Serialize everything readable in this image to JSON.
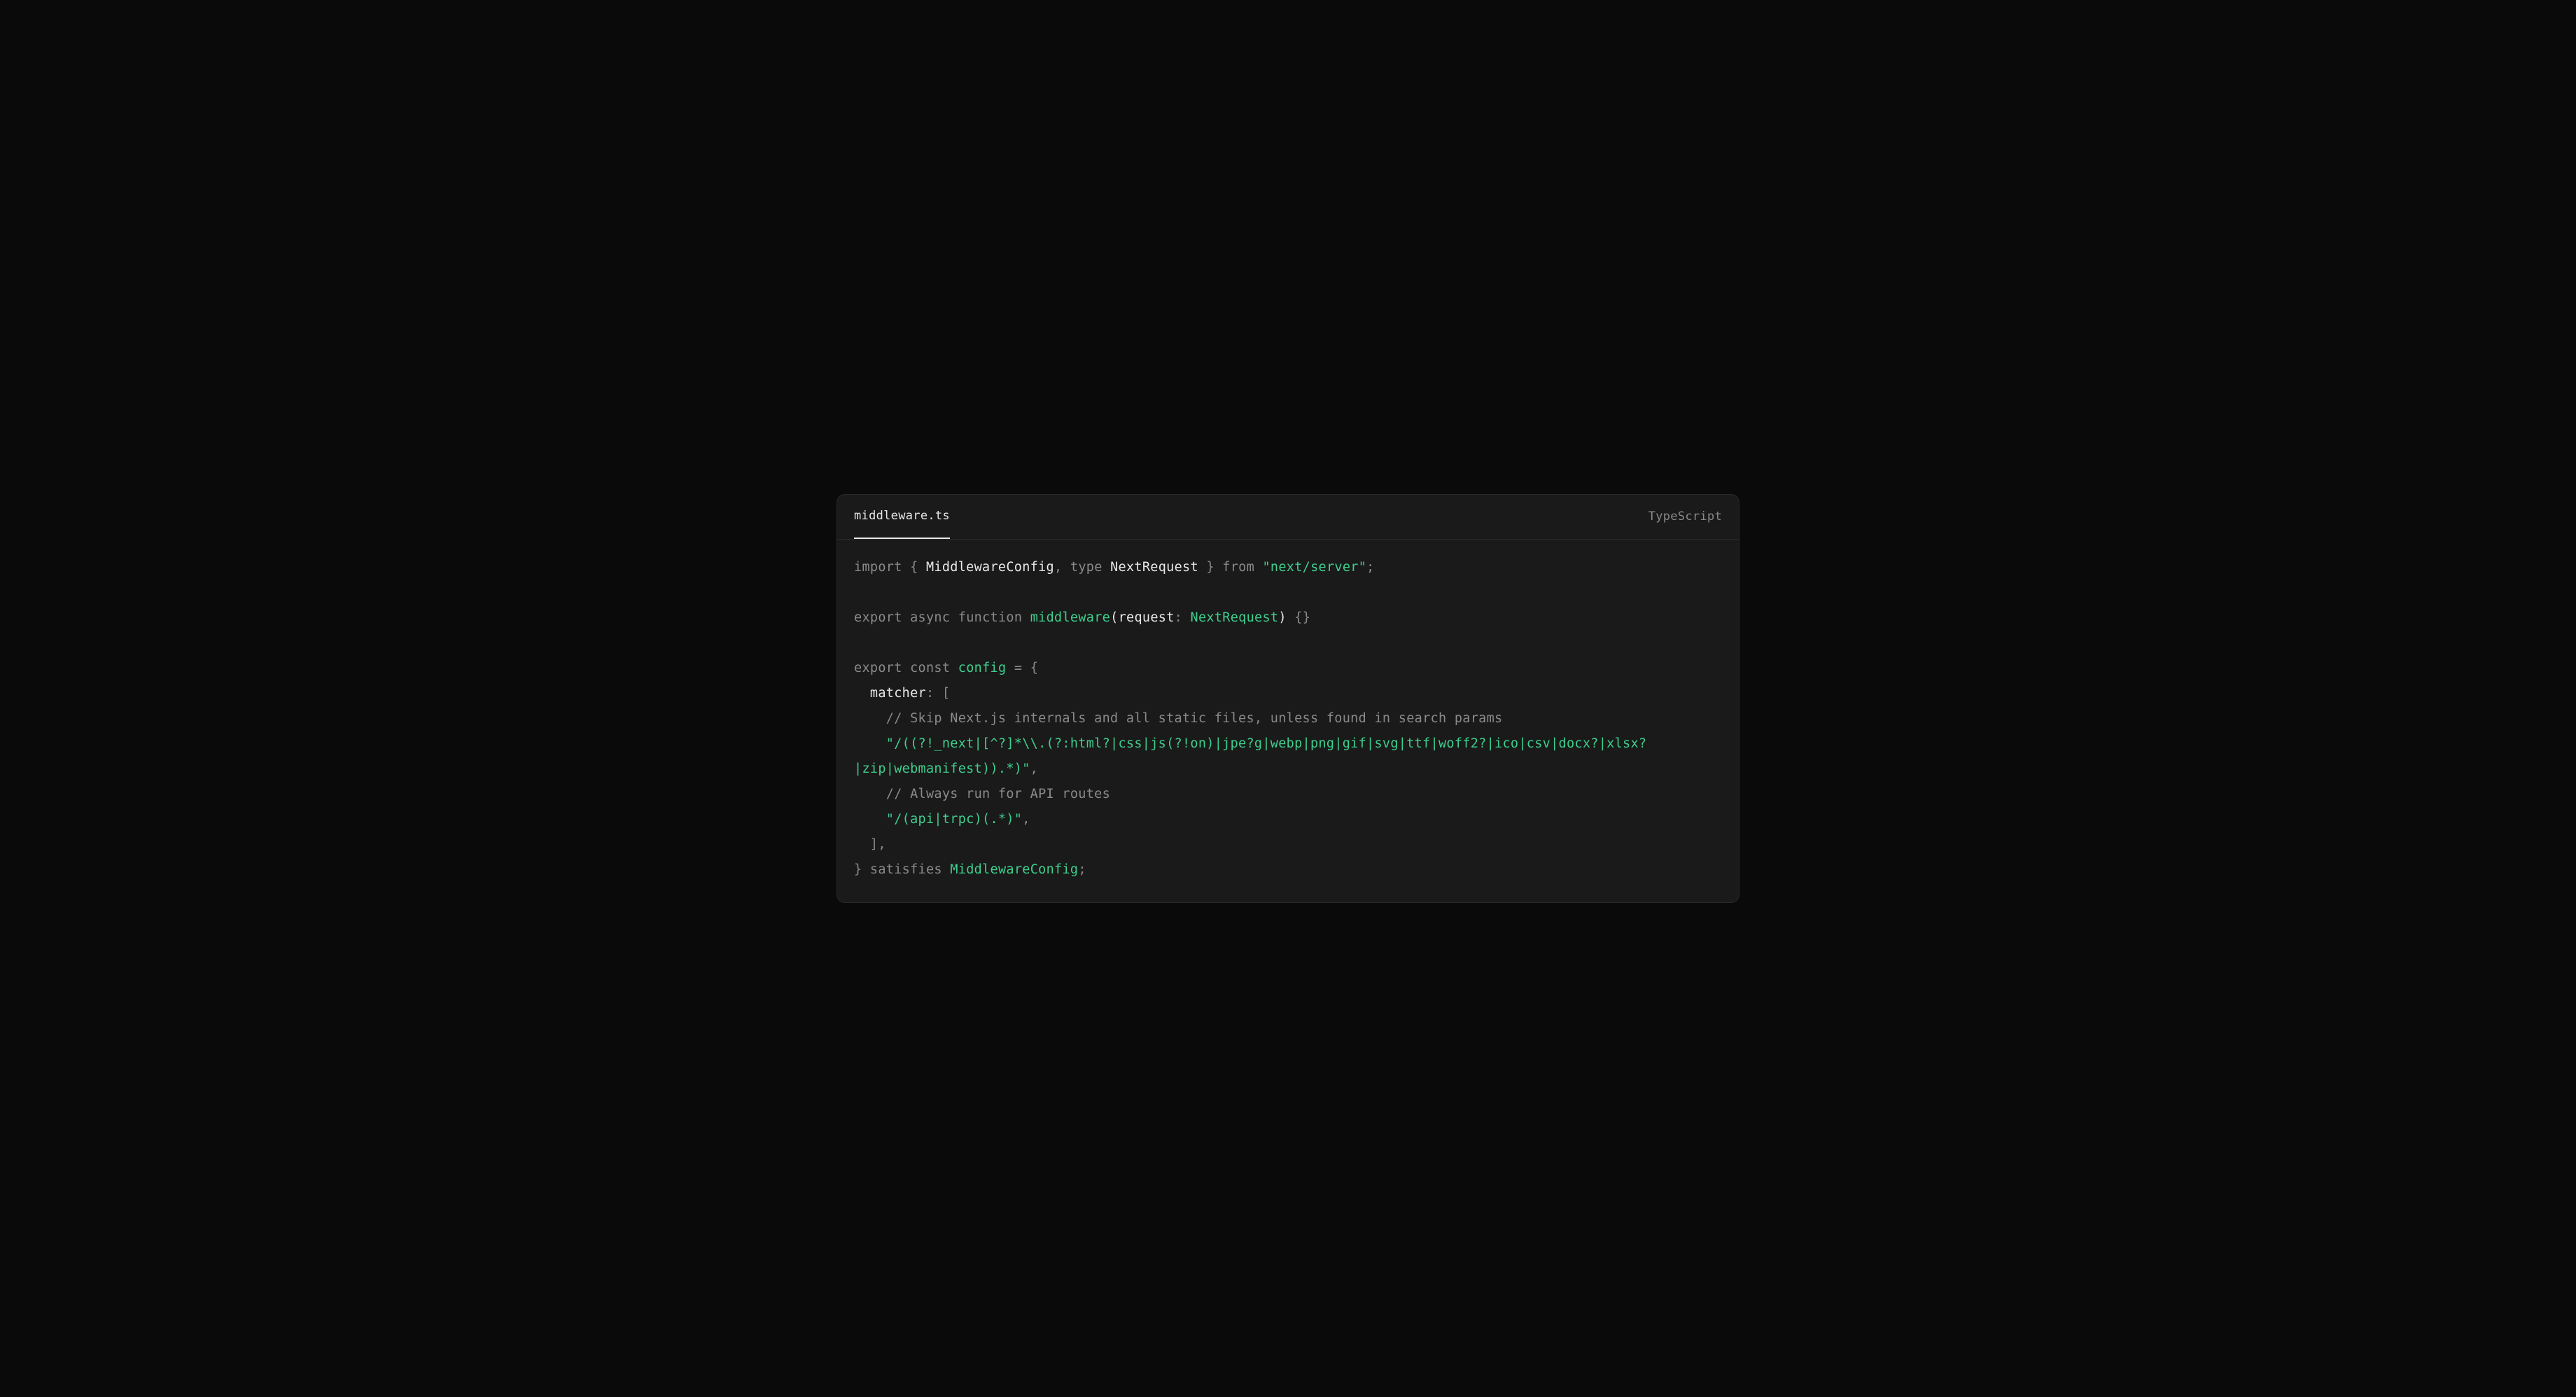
{
  "header": {
    "filename": "middleware.ts",
    "language": "TypeScript"
  },
  "code": {
    "import_kw": "import",
    "import_type1": "MiddlewareConfig",
    "type_kw": "type",
    "import_type2": "NextRequest",
    "from_kw": "from",
    "import_path": "\"next/server\"",
    "export_kw": "export",
    "async_kw": "async",
    "function_kw": "function",
    "fn_name": "middleware",
    "param_name": "request",
    "param_type": "NextRequest",
    "const_kw": "const",
    "config_name": "config",
    "matcher_key": "matcher",
    "comment1": "// Skip Next.js internals and all static files, unless found in search params",
    "matcher_str1": "\"/((?!_next|[^?]*\\\\.(?:html?|css|js(?!on)|jpe?g|webp|png|gif|svg|ttf|woff2?|ico|csv|docx?|xlsx?|zip|webmanifest)).*)\"",
    "comment2": "// Always run for API routes",
    "matcher_str2": "\"/(api|trpc)(.*)\"",
    "satisfies_kw": "satisfies",
    "satisfies_type": "MiddlewareConfig"
  }
}
